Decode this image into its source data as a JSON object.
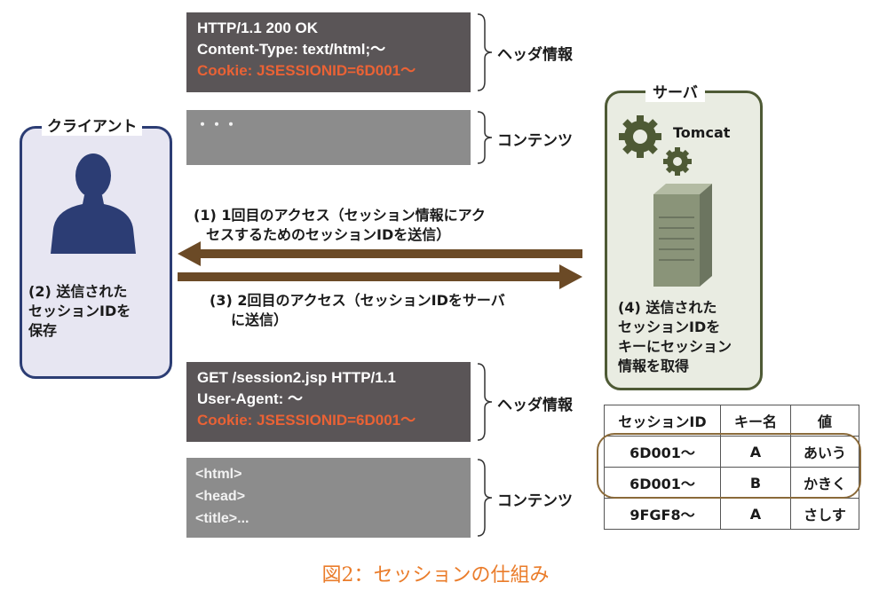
{
  "response": {
    "line1": "HTTP/1.1 200 OK",
    "line2": "Content-Type: text/html;〜",
    "cookie": "Cookie: JSESSIONID=6D001〜",
    "content": "・・・",
    "header_label": "ヘッダ情報",
    "content_label": "コンテンツ"
  },
  "request": {
    "line1": "GET /session2.jsp HTTP/1.1",
    "line2": "User-Agent: 〜",
    "cookie": "Cookie: JSESSIONID=6D001〜",
    "content1": "<html>",
    "content2": "<head>",
    "content3": "<title>...",
    "header_label": "ヘッダ情報",
    "content_label": "コンテンツ"
  },
  "client": {
    "title": "クライアント",
    "note_line1": "(2) 送信された",
    "note_line2": "セッションIDを",
    "note_line3": "保存"
  },
  "server": {
    "title": "サーバ",
    "product": "Tomcat",
    "note_line1": "(4) 送信された",
    "note_line2": "セッションIDを",
    "note_line3": "キーにセッション",
    "note_line4": "情報を取得"
  },
  "messages": {
    "step1_line1": "(1) 1回目のアクセス（セッション情報にアク",
    "step1_line2": "セスするためのセッションIDを送信）",
    "step3_line1": "(3) 2回目のアクセス（セッションIDをサーバ",
    "step3_line2": "に送信）"
  },
  "table": {
    "headers": [
      "セッションID",
      "キー名",
      "値"
    ],
    "rows": [
      [
        "6D001〜",
        "A",
        "あいう"
      ],
      [
        "6D001〜",
        "B",
        "かきく"
      ],
      [
        "9FGF8〜",
        "A",
        "さしす"
      ]
    ]
  },
  "caption": "図2：セッションの仕組み",
  "colors": {
    "dark_box": "#5a5557",
    "gray_box": "#8c8c8c",
    "cookie": "#ea6235",
    "arrow": "#6b4a26",
    "client_border": "#2c3d74",
    "server_border": "#4e5a35",
    "caption": "#ea7c2a"
  }
}
